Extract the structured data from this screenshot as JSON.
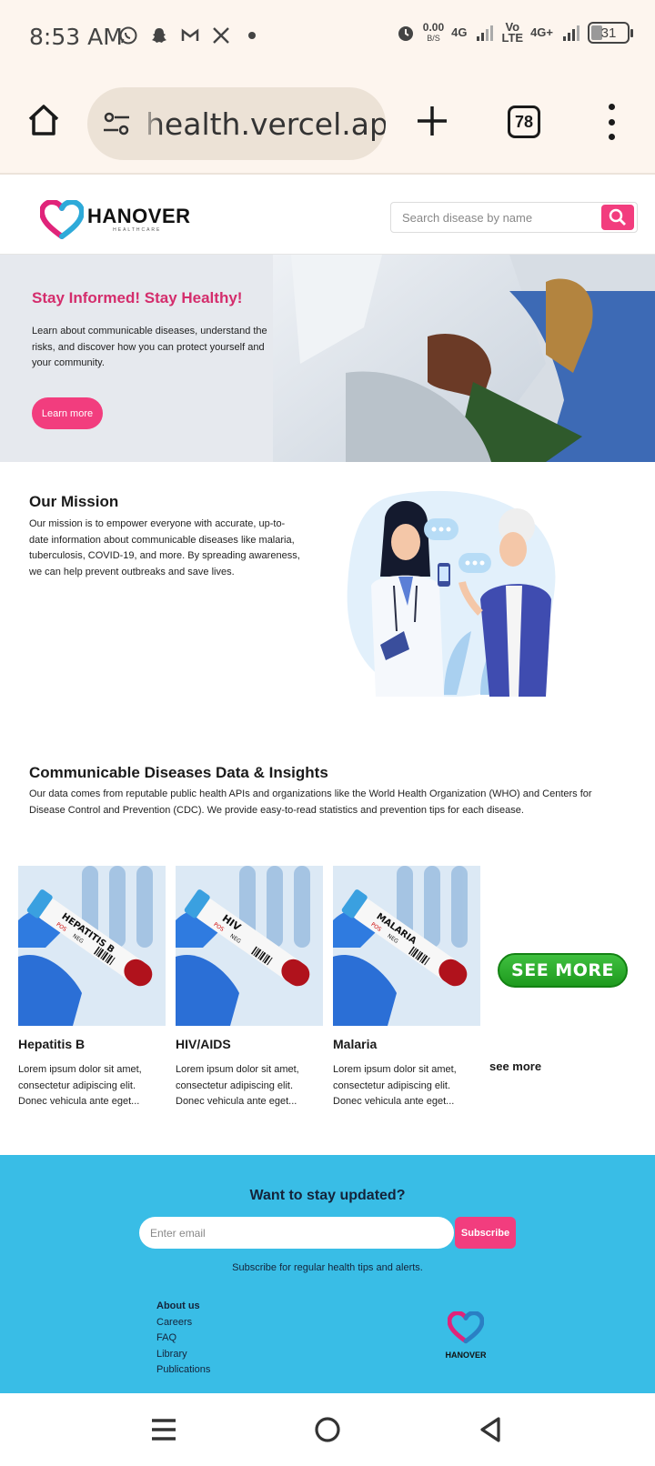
{
  "status_bar": {
    "time": "8:53 AM",
    "speed_value": "0.00",
    "speed_unit": "B/S",
    "net1": "4G",
    "net2_top": "Vo",
    "net2_bottom": "LTE",
    "net3": "4G+",
    "battery": "31",
    "left_icons": [
      "whatsapp-icon",
      "snapchat-icon",
      "gmail-icon",
      "x-icon",
      "dot-icon"
    ],
    "right_icons": [
      "alarm-icon",
      "signal-icon",
      "battery-icon"
    ]
  },
  "browser": {
    "url": "health.vercel.app",
    "tab_count": "78"
  },
  "header": {
    "logo_text": "HANOVER",
    "logo_subtext": "HEALTHCARE",
    "search_placeholder": "Search disease by name"
  },
  "hero": {
    "title": "Stay Informed! Stay Healthy!",
    "text": "Learn about communicable diseases, understand the risks, and discover how you can protect yourself and your community.",
    "button": "Learn more"
  },
  "mission": {
    "title": "Our Mission",
    "text": "Our mission is to empower everyone with accurate, up-to-date information about communicable diseases like malaria, tuberculosis, COVID-19, and more. By spreading awareness, we can help prevent outbreaks and save lives."
  },
  "data_section": {
    "title": "Communicable Diseases Data & Insights",
    "text": "Our data comes from reputable public health APIs and organizations like the World Health Organization (WHO) and Centers for Disease Control and Prevention (CDC). We provide easy-to-read statistics and prevention tips for each disease."
  },
  "cards": [
    {
      "label": "HEPATITIS B",
      "title": "Hepatitis B",
      "desc": "Lorem ipsum dolor sit amet, consectetur adipiscing elit. Donec vehicula ante eget..."
    },
    {
      "label": "HIV",
      "title": "HIV/AIDS",
      "desc": "Lorem ipsum dolor sit amet, consectetur adipiscing elit. Donec vehicula ante eget..."
    },
    {
      "label": "MALARIA",
      "title": "Malaria",
      "desc": "Lorem ipsum dolor sit amet, consectetur adipiscing elit. Donec vehicula ante eget..."
    }
  ],
  "tube_labels": {
    "pos": "POS",
    "neg": "NEG"
  },
  "see_more_button": "SEE MORE",
  "see_more_link": "see more",
  "newsletter": {
    "title": "Want to stay updated?",
    "placeholder": "Enter email",
    "button": "Subscribe",
    "subtitle": "Subscribe for regular health tips and alerts."
  },
  "footer": {
    "links": [
      "About us",
      "Careers",
      "FAQ",
      "Library",
      "Publications"
    ],
    "logo_text": "HANOVER"
  },
  "colors": {
    "accent_pink": "#f23d7e",
    "hero_title": "#d42d6c",
    "footer_bg": "#39bde6",
    "see_more_green": "#2bb02b"
  }
}
